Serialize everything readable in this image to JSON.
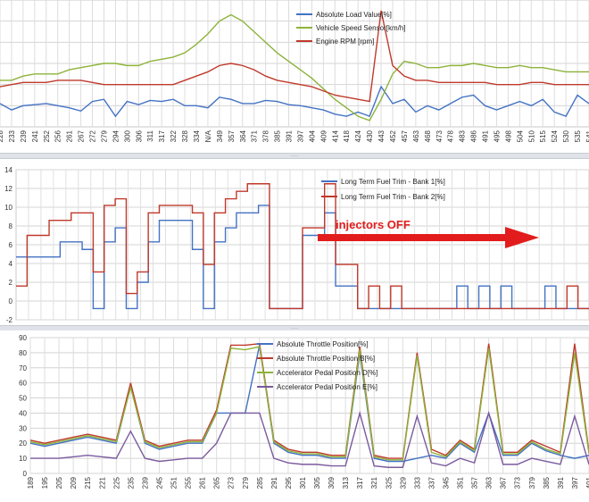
{
  "chart_data": [
    {
      "type": "line",
      "title": "",
      "categories": [
        "228",
        "233",
        "239",
        "241",
        "252",
        "256",
        "261",
        "267",
        "272",
        "279",
        "294",
        "300",
        "306",
        "311",
        "317",
        "322",
        "328",
        "334",
        "N/A",
        "349",
        "357",
        "364",
        "371",
        "378",
        "385",
        "391",
        "397",
        "404",
        "409",
        "414",
        "418",
        "424",
        "430",
        "443",
        "452",
        "457",
        "463",
        "468",
        "473",
        "478",
        "483",
        "486",
        "491",
        "495",
        "498",
        "504",
        "510",
        "515",
        "524",
        "530",
        "535",
        "541"
      ],
      "legend": {
        "position": "top-right"
      },
      "series": [
        {
          "name": "Absolute Load Value[%]",
          "color": "#4472c4",
          "values": [
            22,
            16,
            20,
            21,
            22,
            20,
            18,
            15,
            24,
            26,
            10,
            24,
            21,
            25,
            24,
            26,
            20,
            20,
            18,
            28,
            26,
            22,
            22,
            25,
            24,
            21,
            20,
            18,
            16,
            12,
            10,
            14,
            10,
            38,
            22,
            26,
            14,
            20,
            16,
            22,
            28,
            30,
            20,
            16,
            20,
            24,
            20,
            26,
            14,
            10,
            30,
            22
          ]
        },
        {
          "name": "Vehicle Speed Sensor[km/h]",
          "color": "#8db33a",
          "values": [
            44,
            44,
            48,
            50,
            50,
            50,
            54,
            56,
            58,
            60,
            60,
            58,
            58,
            62,
            64,
            66,
            70,
            78,
            88,
            100,
            106,
            100,
            90,
            80,
            70,
            62,
            54,
            46,
            36,
            26,
            18,
            10,
            6,
            26,
            50,
            62,
            60,
            56,
            56,
            58,
            58,
            60,
            58,
            56,
            56,
            58,
            56,
            56,
            54,
            52,
            52,
            52
          ]
        },
        {
          "name": "Engine RPM [rpm]",
          "color": "#c0392b",
          "values": [
            38,
            40,
            42,
            42,
            42,
            44,
            44,
            44,
            42,
            40,
            40,
            40,
            40,
            40,
            40,
            40,
            44,
            48,
            52,
            58,
            60,
            58,
            54,
            48,
            44,
            42,
            40,
            38,
            34,
            30,
            28,
            26,
            24,
            110,
            58,
            48,
            44,
            44,
            42,
            42,
            42,
            42,
            42,
            40,
            40,
            40,
            42,
            42,
            40,
            40,
            40,
            40
          ]
        }
      ],
      "ylim": [
        0,
        120
      ],
      "grid": true
    },
    {
      "type": "line",
      "title": "",
      "x": [],
      "ylabel": "",
      "yticks": [
        -2,
        0,
        2,
        4,
        6,
        8,
        10,
        12,
        14
      ],
      "ylim": [
        -2,
        14
      ],
      "legend": {
        "position": "top-right"
      },
      "annotation": {
        "text": "injectors OFF",
        "color": "#e21c1c"
      },
      "series": [
        {
          "name": "Long Term Fuel Trim - Bank 1[%]",
          "color": "#4472c4",
          "values": [
            4.7,
            4.7,
            4.7,
            4.7,
            6.3,
            6.3,
            5.5,
            -0.8,
            6.3,
            7.8,
            -0.8,
            2,
            6.3,
            8.6,
            8.6,
            8.6,
            5.5,
            -0.8,
            6.3,
            7.8,
            9.4,
            9.4,
            10.2,
            -0.8,
            -0.8,
            -0.8,
            7,
            7,
            9.4,
            1.6,
            1.6,
            -0.8,
            -0.8,
            -0.8,
            -0.8,
            -0.8,
            -0.8,
            -0.8,
            -0.8,
            -0.8,
            1.6,
            -0.8,
            1.6,
            -0.8,
            1.6,
            -0.8,
            -0.8,
            -0.8,
            1.6,
            -0.8,
            -0.8,
            -0.8,
            -0.8
          ]
        },
        {
          "name": "Long Term Fuel Trim - Bank 2[%]",
          "color": "#c0392b",
          "values": [
            1.6,
            7,
            7,
            8.6,
            8.6,
            9.4,
            9.4,
            3.1,
            10.2,
            10.9,
            0.8,
            3.1,
            9.4,
            10.2,
            10.2,
            10.2,
            9.4,
            3.9,
            9.4,
            10.9,
            11.7,
            12.5,
            12.5,
            -0.8,
            -0.8,
            -0.8,
            7.8,
            7.8,
            12.5,
            3.9,
            3.9,
            -0.8,
            1.6,
            -0.8,
            1.6,
            -0.8,
            -0.8,
            -0.8,
            -0.8,
            -0.8,
            -0.8,
            -0.8,
            -0.8,
            -0.8,
            -0.8,
            -0.8,
            -0.8,
            -0.8,
            -0.8,
            -0.8,
            1.6,
            -0.8,
            -0.8
          ]
        }
      ],
      "grid": true
    },
    {
      "type": "line",
      "title": "",
      "categories": [
        "189",
        "195",
        "205",
        "209",
        "215",
        "221",
        "225",
        "235",
        "239",
        "245",
        "251",
        "255",
        "261",
        "265",
        "273",
        "279",
        "285",
        "291",
        "295",
        "301",
        "305",
        "309",
        "313",
        "317",
        "321",
        "325",
        "329",
        "333",
        "337",
        "345",
        "351",
        "357",
        "363",
        "367",
        "373",
        "379",
        "385",
        "391",
        "397",
        "401"
      ],
      "yticks": [
        0,
        10,
        20,
        30,
        40,
        50,
        60,
        70,
        80,
        90
      ],
      "ylim": [
        0,
        90
      ],
      "legend": {
        "position": "top-right"
      },
      "series": [
        {
          "name": "Absolute Throttle Position[%]",
          "color": "#4472c4",
          "values": [
            20,
            18,
            20,
            22,
            24,
            22,
            20,
            58,
            20,
            16,
            18,
            20,
            20,
            40,
            40,
            40,
            85,
            20,
            14,
            12,
            12,
            10,
            10,
            80,
            10,
            8,
            8,
            10,
            12,
            10,
            20,
            14,
            40,
            12,
            12,
            20,
            15,
            12,
            10,
            12
          ]
        },
        {
          "name": "Absolute Throttle Position B[%]",
          "color": "#c0392b",
          "values": [
            22,
            20,
            22,
            24,
            26,
            24,
            22,
            60,
            22,
            18,
            20,
            22,
            22,
            42,
            85,
            85,
            86,
            22,
            16,
            14,
            14,
            12,
            12,
            84,
            12,
            10,
            10,
            80,
            16,
            12,
            22,
            16,
            86,
            14,
            14,
            22,
            18,
            14,
            86,
            14
          ]
        },
        {
          "name": "Accelerator Pedal Position D[%]",
          "color": "#8db33a",
          "values": [
            21,
            19,
            21,
            23,
            25,
            23,
            21,
            57,
            21,
            17,
            19,
            21,
            21,
            40,
            83,
            82,
            84,
            21,
            15,
            13,
            13,
            11,
            11,
            82,
            11,
            9,
            9,
            78,
            14,
            11,
            21,
            15,
            83,
            13,
            13,
            21,
            16,
            13,
            80,
            13
          ]
        },
        {
          "name": "Accelerator Pedal Position E[%]",
          "color": "#7a5a9e",
          "values": [
            10,
            10,
            10,
            11,
            12,
            11,
            10,
            28,
            10,
            8,
            9,
            10,
            10,
            20,
            40,
            40,
            40,
            10,
            7,
            6,
            6,
            5,
            5,
            40,
            5,
            4,
            4,
            38,
            7,
            5,
            10,
            7,
            40,
            6,
            6,
            10,
            8,
            6,
            38,
            6
          ]
        }
      ],
      "grid": true
    }
  ]
}
